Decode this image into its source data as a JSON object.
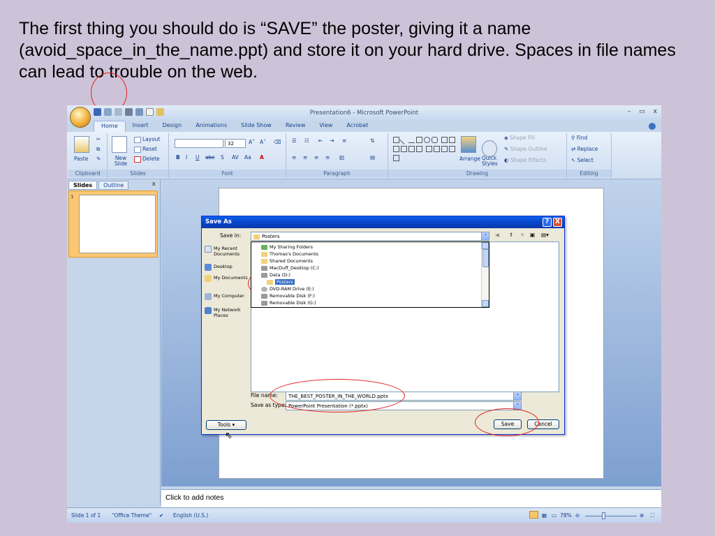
{
  "caption": "The first thing you should do is “SAVE” the poster, giving it a name (avoid_space_in_the_name.ppt) and store it on your hard drive. Spaces in file names can lead to trouble on the web.",
  "window": {
    "title": "Presentation6 - Microsoft PowerPoint",
    "tabs": [
      "Home",
      "Insert",
      "Design",
      "Animations",
      "Slide Show",
      "Review",
      "View",
      "Acrobat"
    ],
    "minimize": "–",
    "restore": "▭",
    "close": "x"
  },
  "ribbon": {
    "clipboard": {
      "label": "Clipboard",
      "paste": "Paste"
    },
    "slides": {
      "label": "Slides",
      "new_slide": "New Slide",
      "layout": "Layout",
      "reset": "Reset",
      "delete": "Delete"
    },
    "font": {
      "label": "Font",
      "size": "32"
    },
    "paragraph": {
      "label": "Paragraph"
    },
    "drawing": {
      "label": "Drawing",
      "arrange": "Arrange",
      "quick_styles": "Quick Styles",
      "shape_fill": "Shape Fill",
      "shape_outline": "Shape Outline",
      "shape_effects": "Shape Effects"
    },
    "editing": {
      "label": "Editing",
      "find": "Find",
      "replace": "Replace",
      "select": "Select"
    }
  },
  "pane": {
    "tab_slides": "Slides",
    "tab_outline": "Outline",
    "close": "x",
    "slide_number": "1"
  },
  "notes_placeholder": "Click to add notes",
  "status": {
    "slide": "Slide 1 of 1",
    "theme": "\"Office Theme\"",
    "language": "English (U.S.)",
    "zoom": "78%"
  },
  "dialog": {
    "title": "Save As",
    "save_in_label": "Save in:",
    "save_in_value": "Posters",
    "places": [
      "My Recent Documents",
      "Desktop",
      "My Documents",
      "My Computer",
      "My Network Places"
    ],
    "locations": [
      "My Sharing Folders",
      "Thomas's Documents",
      "Shared Documents",
      "MacDuff_Desktop (C:)",
      "Data (D:)",
      "Posters",
      "DVD-RAM Drive (E:)",
      "Removable Disk (F:)",
      "Removable Disk (G:)"
    ],
    "file_name_label": "File name:",
    "file_name_value": "THE_BEST_POSTER_IN_THE_WORLD.pptx",
    "save_as_type_label": "Save as type:",
    "save_as_type_value": "PowerPoint Presentation (*.pptx)",
    "tools": "Tools",
    "save": "Save",
    "cancel": "Cancel",
    "help": "?",
    "close": "X"
  }
}
